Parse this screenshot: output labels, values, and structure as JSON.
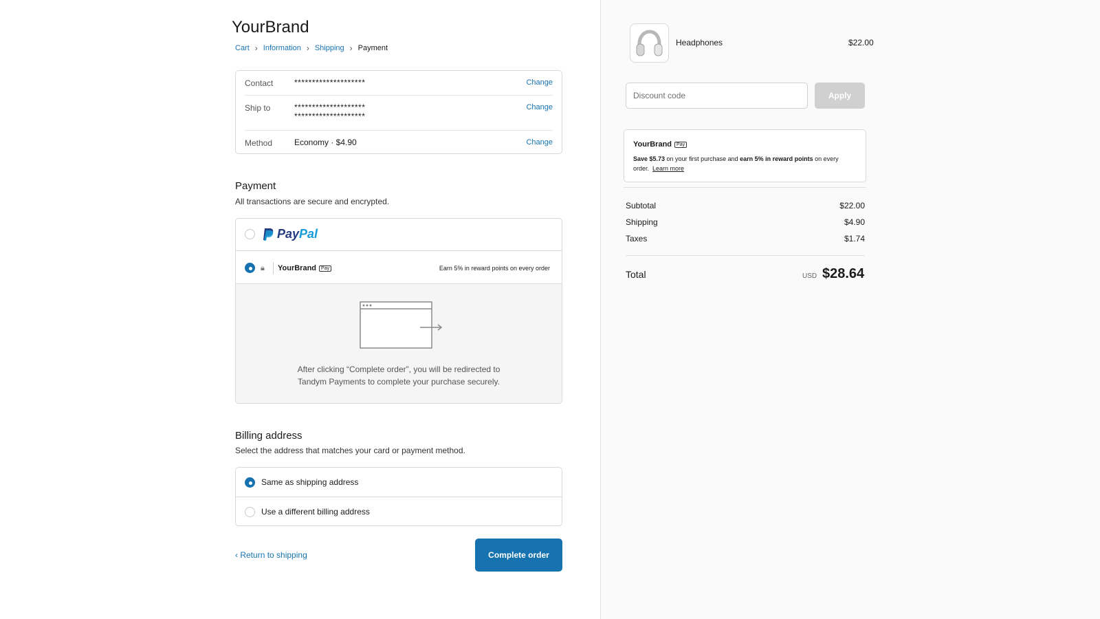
{
  "brand": "YourBrand",
  "breadcrumb": {
    "cart": "Cart",
    "information": "Information",
    "shipping": "Shipping",
    "payment": "Payment"
  },
  "review": {
    "contact_label": "Contact",
    "contact_value": "********************",
    "ship_label": "Ship to",
    "ship_value_1": "********************",
    "ship_value_2": "********************",
    "method_label": "Method",
    "method_value": "Economy · $4.90",
    "change": "Change"
  },
  "payment": {
    "title": "Payment",
    "subtitle": "All transactions are secure and encrypted.",
    "paypal_a": "Pay",
    "paypal_b": "Pal",
    "yourbrand_label": "YourBrand",
    "pay_tag": "Pay",
    "yourbrand_note": "Earn 5% in reward points on every order",
    "redirect_line1": "After clicking “Complete order”, you will be redirected to",
    "redirect_line2": "Tandym Payments to complete your purchase securely."
  },
  "billing": {
    "title": "Billing address",
    "subtitle": "Select the address that matches your card or payment method.",
    "same": "Same as shipping address",
    "different": "Use a different billing address"
  },
  "footer": {
    "return": "Return to shipping",
    "complete": "Complete order"
  },
  "summary": {
    "product_name": "Headphones",
    "product_price": "$22.00",
    "discount_placeholder": "Discount code",
    "apply": "Apply",
    "promo_brand": "YourBrand",
    "promo_pay_tag": "Pay",
    "promo_save": "Save $5.73",
    "promo_mid": " on your first purchase and ",
    "promo_earn": "earn 5% in reward points",
    "promo_end": " on every order.",
    "promo_learn": "Learn more",
    "subtotal_label": "Subtotal",
    "subtotal_value": "$22.00",
    "shipping_label": "Shipping",
    "shipping_value": "$4.90",
    "taxes_label": "Taxes",
    "taxes_value": "$1.74",
    "total_label": "Total",
    "currency": "USD",
    "total_value": "$28.64"
  },
  "colors": {
    "accent": "#1773b0",
    "paypal_dark": "#253b80",
    "paypal_light": "#179bd7"
  }
}
